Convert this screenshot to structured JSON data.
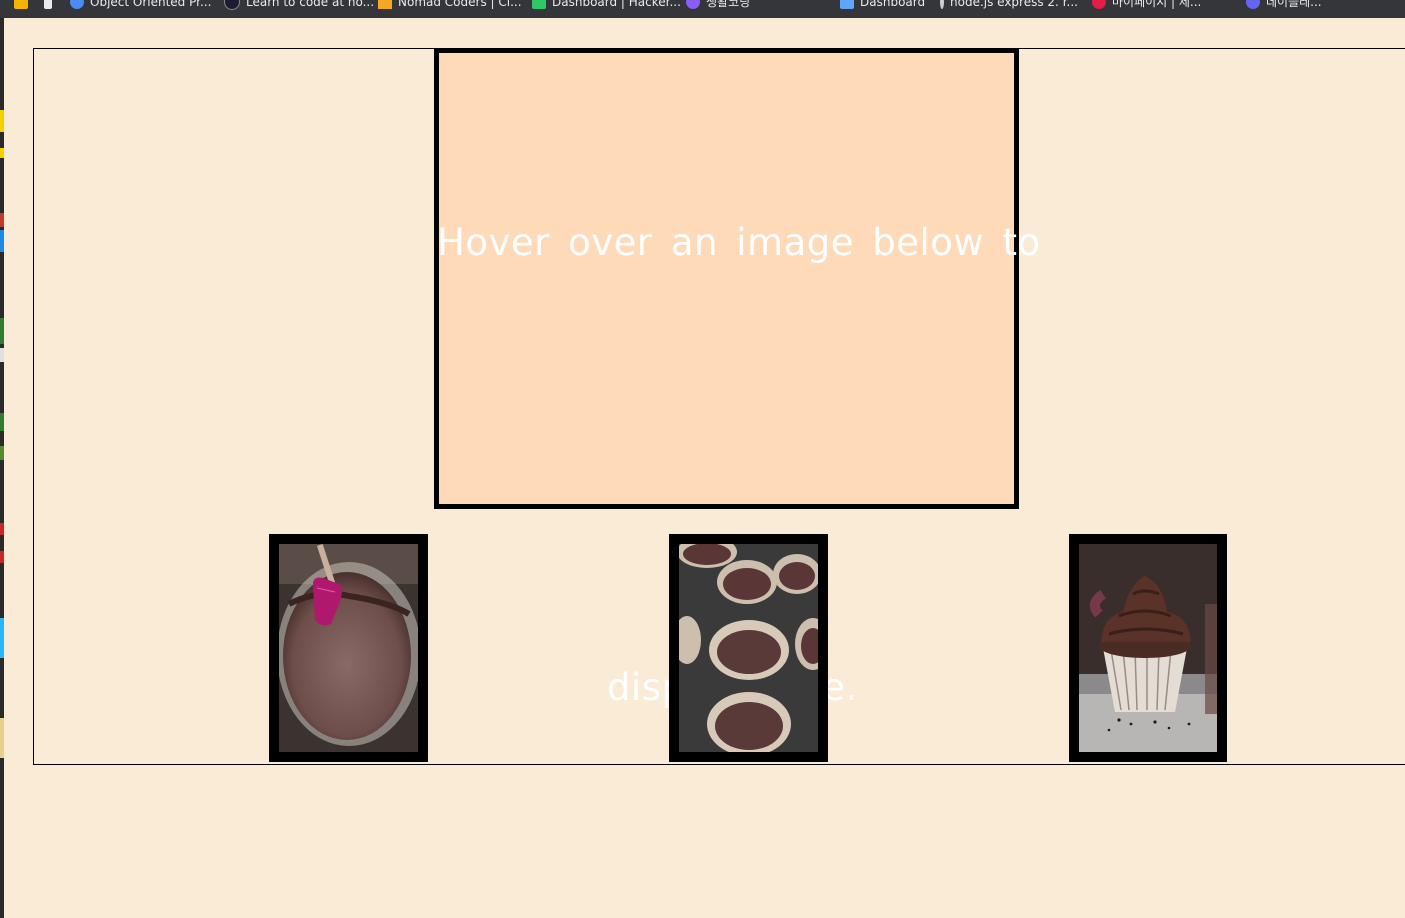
{
  "bookmarks": [
    {
      "label": "Object Oriented Pr...",
      "icon": "infinity-icon",
      "color": "#4b8bf5"
    },
    {
      "label": "Learn to code at ho...",
      "icon": "n-logo-icon",
      "color": "#1b1b32"
    },
    {
      "label": "Nomad Coders | Cl...",
      "icon": "warning-triangle-icon",
      "color": "#f5a623"
    },
    {
      "label": "Dashboard | Hacker...",
      "icon": "hackerrank-icon",
      "color": "#2ec866"
    },
    {
      "label": "생활코딩",
      "icon": "globe-icon",
      "color": "#8b5cf6"
    },
    {
      "label": "Dashboard",
      "icon": "grid-icon",
      "color": "#60a5fa"
    },
    {
      "label": "node.js express 2. r...",
      "icon": "more-vertical-icon",
      "color": "#cfcfcf"
    },
    {
      "label": "마이페이지 | 제...",
      "icon": "heart-icon",
      "color": "#e11d48"
    },
    {
      "label": "데이블레...",
      "icon": "plus-circle-icon",
      "color": "#6366f1"
    }
  ],
  "display": {
    "text_line1": "Hover over an image below to",
    "text_line2": "display here."
  },
  "thumbnails": [
    {
      "alt": "chocolate batter in glass bowl with pink spatula",
      "icon": "batter-bowl-image"
    },
    {
      "alt": "chocolate batter in cupcake liners in muffin tin",
      "icon": "muffin-tin-image"
    },
    {
      "alt": "chocolate cupcake with chocolate frosting",
      "icon": "frosted-cupcake-image"
    }
  ],
  "colors": {
    "page_background": "#faebd7",
    "display_background": "#ffdab9",
    "border": "#000000",
    "text": "#ffffff"
  }
}
